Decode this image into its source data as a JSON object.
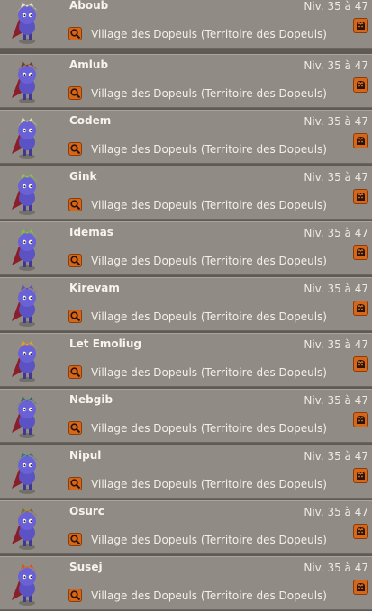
{
  "monsters": [
    {
      "name": "Aboub",
      "level": "Niv. 35 à 47",
      "location": "Village des Dopeuls (Territoire des Dopeuls)",
      "hat_color": "#e8e4c8",
      "hat_icon": "white-spiky-hair"
    },
    {
      "name": "Amlub",
      "level": "Niv. 35 à 47",
      "location": "Village des Dopeuls (Territoire des Dopeuls)",
      "hat_color": "#7a3b1e",
      "hat_icon": "brown-hair"
    },
    {
      "name": "Codem",
      "level": "Niv. 35 à 47",
      "location": "Village des Dopeuls (Territoire des Dopeuls)",
      "hat_color": "#e6e0a0",
      "hat_icon": "antennae"
    },
    {
      "name": "Gink",
      "level": "Niv. 35 à 47",
      "location": "Village des Dopeuls (Territoire des Dopeuls)",
      "hat_color": "#8cc63f",
      "hat_icon": "green-hood"
    },
    {
      "name": "Idemas",
      "level": "Niv. 35 à 47",
      "location": "Village des Dopeuls (Territoire des Dopeuls)",
      "hat_color": "#7cc242",
      "hat_icon": "green-cap"
    },
    {
      "name": "Kirevam",
      "level": "Niv. 35 à 47",
      "location": "Village des Dopeuls (Territoire des Dopeuls)",
      "hat_color": "#6a4fb0",
      "hat_icon": "purple-ears"
    },
    {
      "name": "Let Emoliug",
      "level": "Niv. 35 à 47",
      "location": "Village des Dopeuls (Territoire des Dopeuls)",
      "hat_color": "#e6a020",
      "hat_icon": "orange-hair"
    },
    {
      "name": "Nebgib",
      "level": "Niv. 35 à 47",
      "location": "Village des Dopeuls (Territoire des Dopeuls)",
      "hat_color": "#2f6e6a",
      "hat_icon": "wizard-hat"
    },
    {
      "name": "Nipul",
      "level": "Niv. 35 à 47",
      "location": "Village des Dopeuls (Territoire des Dopeuls)",
      "hat_color": "#2a7a82",
      "hat_icon": "teal-hood"
    },
    {
      "name": "Osurc",
      "level": "Niv. 35 à 47",
      "location": "Village des Dopeuls (Territoire des Dopeuls)",
      "hat_color": "#8a6a2a",
      "hat_icon": "wide-hat"
    },
    {
      "name": "Susej",
      "level": "Niv. 35 à 47",
      "location": "Village des Dopeuls (Territoire des Dopeuls)",
      "hat_color": "#e0501e",
      "hat_icon": "flame-hair"
    }
  ],
  "colors": {
    "row_bg": "#908c85",
    "button_orange": "#d6661a",
    "body_purple": "#5b52c4",
    "cape_red": "#8a1f2a"
  },
  "icons": {
    "locate": "magnifier-icon",
    "fight": "fight-icon"
  }
}
